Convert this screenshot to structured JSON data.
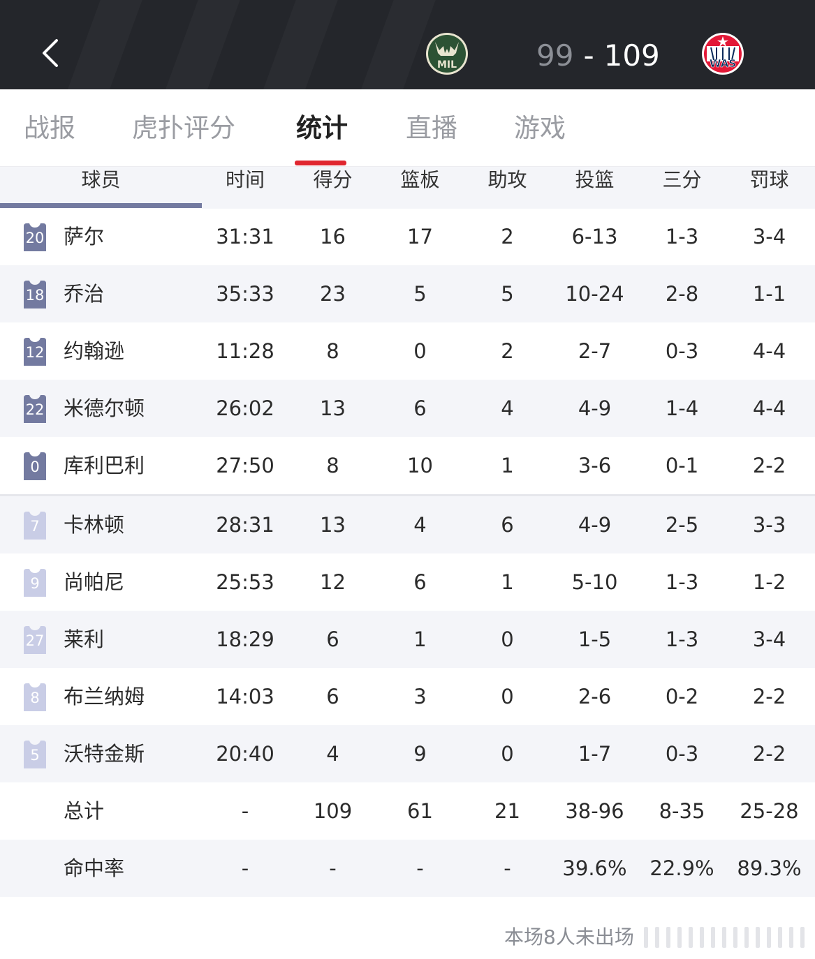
{
  "header": {
    "back_icon": "chevron-left-icon",
    "home_team": {
      "abbr": "MIL",
      "score": "99",
      "color": "#2c5234"
    },
    "away_team": {
      "abbr": "WAS",
      "score": "109",
      "color": "#e31837"
    },
    "score_separator": "-"
  },
  "tabs": [
    {
      "label": "战报",
      "active": false
    },
    {
      "label": "虎扑评分",
      "active": false
    },
    {
      "label": "统计",
      "active": true
    },
    {
      "label": "直播",
      "active": false
    },
    {
      "label": "游戏",
      "active": false
    }
  ],
  "table": {
    "headers": [
      "球员",
      "时间",
      "得分",
      "篮板",
      "助攻",
      "投篮",
      "三分",
      "罚球"
    ],
    "starters": [
      {
        "number": "20",
        "name": "萨尔",
        "min": "31:31",
        "pts": "16",
        "reb": "17",
        "ast": "2",
        "fg": "6-13",
        "tp": "1-3",
        "ft": "3-4"
      },
      {
        "number": "18",
        "name": "乔治",
        "min": "35:33",
        "pts": "23",
        "reb": "5",
        "ast": "5",
        "fg": "10-24",
        "tp": "2-8",
        "ft": "1-1"
      },
      {
        "number": "12",
        "name": "约翰逊",
        "min": "11:28",
        "pts": "8",
        "reb": "0",
        "ast": "2",
        "fg": "2-7",
        "tp": "0-3",
        "ft": "4-4"
      },
      {
        "number": "22",
        "name": "米德尔顿",
        "min": "26:02",
        "pts": "13",
        "reb": "6",
        "ast": "4",
        "fg": "4-9",
        "tp": "1-4",
        "ft": "4-4"
      },
      {
        "number": "0",
        "name": "库利巴利",
        "min": "27:50",
        "pts": "8",
        "reb": "10",
        "ast": "1",
        "fg": "3-6",
        "tp": "0-1",
        "ft": "2-2"
      }
    ],
    "bench": [
      {
        "number": "7",
        "name": "卡林顿",
        "min": "28:31",
        "pts": "13",
        "reb": "4",
        "ast": "6",
        "fg": "4-9",
        "tp": "2-5",
        "ft": "3-3"
      },
      {
        "number": "9",
        "name": "尚帕尼",
        "min": "25:53",
        "pts": "12",
        "reb": "6",
        "ast": "1",
        "fg": "5-10",
        "tp": "1-3",
        "ft": "1-2"
      },
      {
        "number": "27",
        "name": "莱利",
        "min": "18:29",
        "pts": "6",
        "reb": "1",
        "ast": "0",
        "fg": "1-5",
        "tp": "1-3",
        "ft": "3-4"
      },
      {
        "number": "8",
        "name": "布兰纳姆",
        "min": "14:03",
        "pts": "6",
        "reb": "3",
        "ast": "0",
        "fg": "2-6",
        "tp": "0-2",
        "ft": "2-2"
      },
      {
        "number": "5",
        "name": "沃特金斯",
        "min": "20:40",
        "pts": "4",
        "reb": "9",
        "ast": "0",
        "fg": "1-7",
        "tp": "0-3",
        "ft": "2-2"
      }
    ],
    "totals": {
      "name": "总计",
      "min": "-",
      "pts": "109",
      "reb": "61",
      "ast": "21",
      "fg": "38-96",
      "tp": "8-35",
      "ft": "25-28"
    },
    "percentages": {
      "name": "命中率",
      "min": "-",
      "pts": "-",
      "reb": "-",
      "ast": "-",
      "fg": "39.6%",
      "tp": "22.9%",
      "ft": "89.3%"
    }
  },
  "footer": {
    "note": "本场8人未出场"
  },
  "colors": {
    "header_bg": "#24262b",
    "tab_active_indicator": "#e0262f",
    "starter_jersey": "#737aa0",
    "bench_jersey": "#c9cde6",
    "alt_row_bg": "#f4f5f9"
  }
}
